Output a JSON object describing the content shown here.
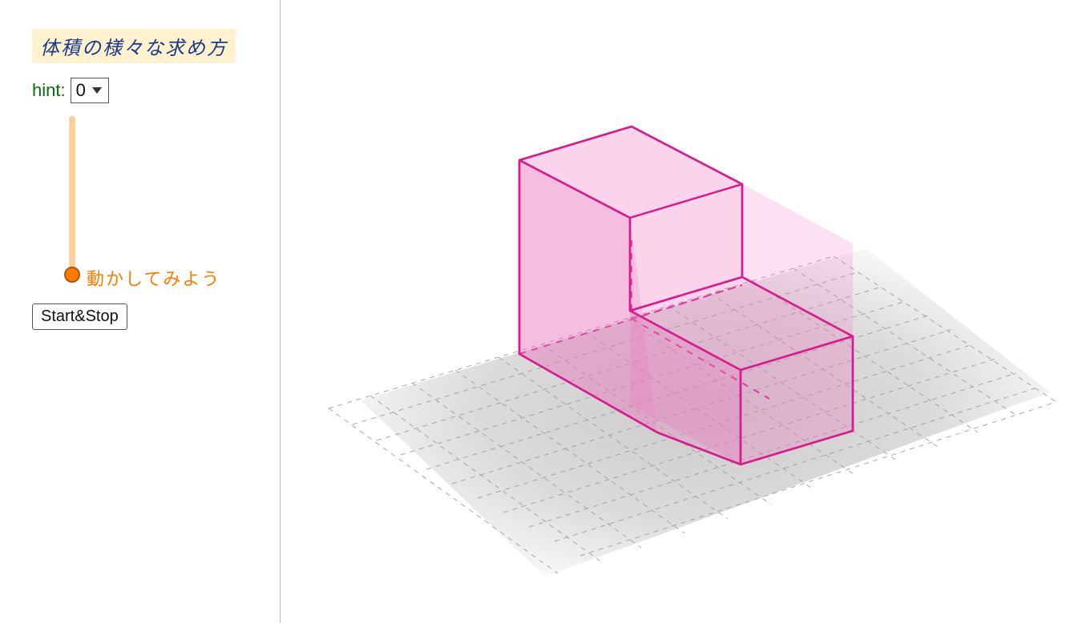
{
  "sidebar": {
    "title": "体積の様々な求め方",
    "hint_label": "hint:",
    "hint_value": "0",
    "slider_caption": "動かしてみよう",
    "start_stop_label": "Start&Stop"
  },
  "scene": {
    "shape_color": "#d81b8e",
    "shape_fill": "rgba(236,120,190,0.35)",
    "grid_color": "#aaaaaa",
    "grid_shadow": "rgba(0,0,0,0.12)"
  }
}
